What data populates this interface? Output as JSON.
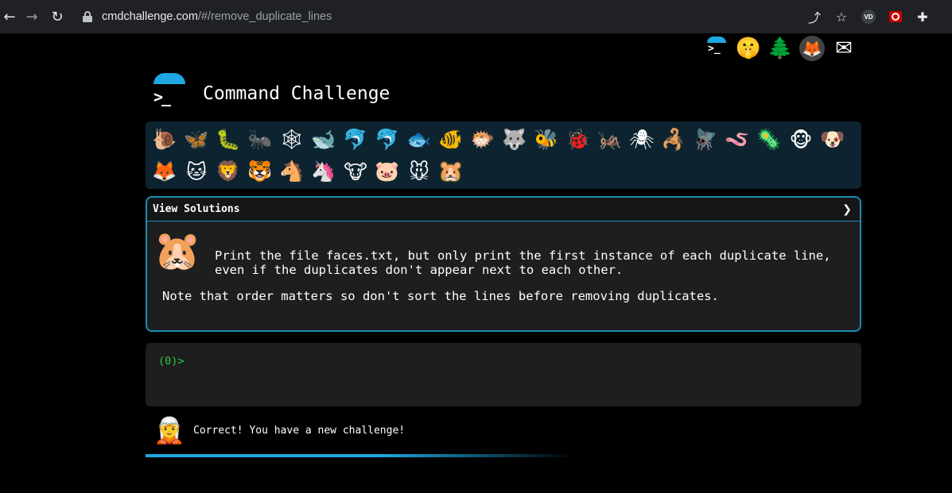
{
  "browser": {
    "url_host": "cmdchallenge.com",
    "url_path": "/#/remove_duplicate_lines",
    "ext_vd_label": "VD"
  },
  "header": {
    "title": "Command Challenge"
  },
  "top_icons": [
    "terminal-logo-icon",
    "shushing-face-icon",
    "evergreen-tree-icon",
    "gitlab-fox-icon",
    "envelope-icon"
  ],
  "challenges": [
    {
      "name": "snail",
      "glyph": "🐌"
    },
    {
      "name": "butterfly",
      "glyph": "🦋"
    },
    {
      "name": "bug",
      "glyph": "🐛"
    },
    {
      "name": "ant",
      "glyph": "🐜"
    },
    {
      "name": "spider-web",
      "glyph": "🕸"
    },
    {
      "name": "whale",
      "glyph": "🐋"
    },
    {
      "name": "dolphin",
      "glyph": "🐬"
    },
    {
      "name": "shark",
      "glyph": "🐬"
    },
    {
      "name": "fish",
      "glyph": "🐟"
    },
    {
      "name": "tropical-fish",
      "glyph": "🐠"
    },
    {
      "name": "blowfish",
      "glyph": "🐡"
    },
    {
      "name": "wolf",
      "glyph": "🐺"
    },
    {
      "name": "bee",
      "glyph": "🐝"
    },
    {
      "name": "ladybug",
      "glyph": "🐞"
    },
    {
      "name": "cricket",
      "glyph": "🦗"
    },
    {
      "name": "spider",
      "glyph": "🕷"
    },
    {
      "name": "scorpion",
      "glyph": "🦂"
    },
    {
      "name": "fly",
      "glyph": "🪰"
    },
    {
      "name": "worm",
      "glyph": "🪱"
    },
    {
      "name": "microbe",
      "glyph": "🦠"
    },
    {
      "name": "monkey",
      "glyph": "🐵"
    },
    {
      "name": "dog",
      "glyph": "🐶"
    },
    {
      "name": "fox",
      "glyph": "🦊"
    },
    {
      "name": "cat",
      "glyph": "🐱"
    },
    {
      "name": "lion",
      "glyph": "🦁"
    },
    {
      "name": "tiger",
      "glyph": "🐯"
    },
    {
      "name": "horse",
      "glyph": "🐴"
    },
    {
      "name": "unicorn",
      "glyph": "🦄"
    },
    {
      "name": "cow",
      "glyph": "🐮"
    },
    {
      "name": "pig",
      "glyph": "🐷"
    },
    {
      "name": "mouse",
      "glyph": "🐭"
    },
    {
      "name": "hamster",
      "glyph": "🐹"
    }
  ],
  "panel": {
    "header_label": "View Solutions",
    "chevron": "❯",
    "icon_glyph": "🐹",
    "description_line1": "Print the file faces.txt, but only print the first instance of each duplicate line,",
    "description_line2": "even if the duplicates don't appear next to each other.",
    "note": "Note that order matters so don't sort the lines before removing duplicates."
  },
  "terminal": {
    "prompt": "(0)>"
  },
  "status": {
    "icon_glyph": "🧝",
    "message": "Correct! You have a new challenge!",
    "progress": 0.55
  },
  "colors": {
    "accent": "#1ea7e0",
    "prompt_green": "#2ecc40",
    "panel_border": "#1a8fb0"
  }
}
